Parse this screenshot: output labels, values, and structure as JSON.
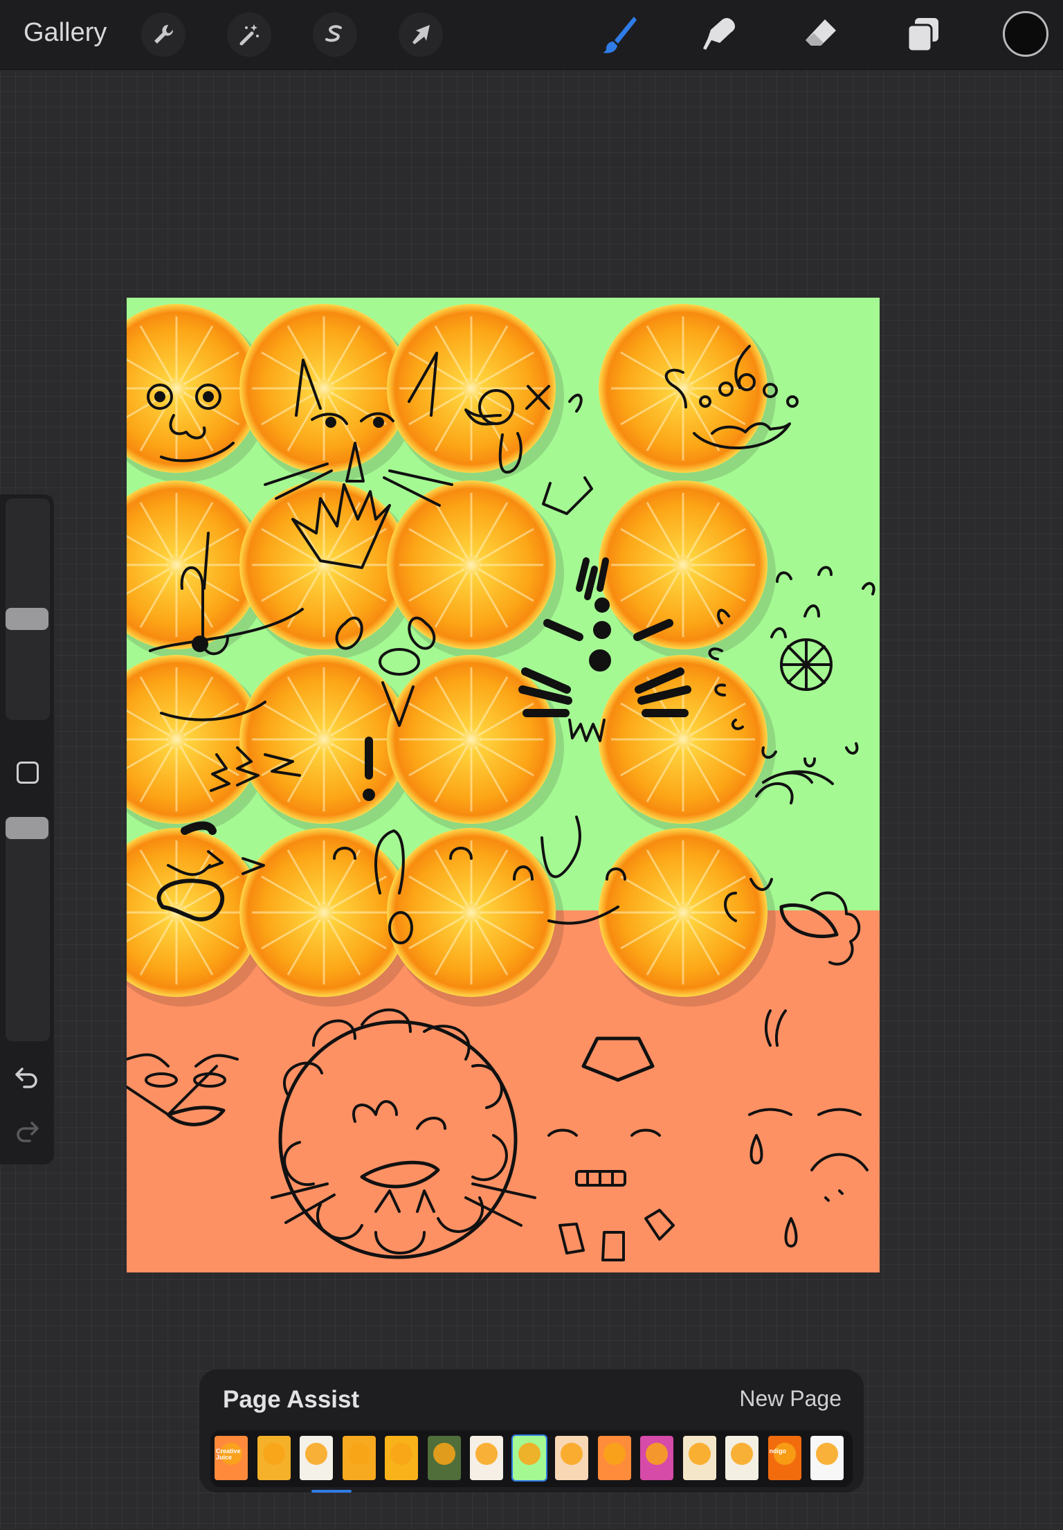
{
  "toolbar": {
    "gallery_label": "Gallery",
    "accent_color": "#2f7ce7",
    "current_color": "#0b0b0b",
    "left_tools": [
      "wrench-icon",
      "magic-wand-icon",
      "selection-icon",
      "transform-arrow-icon"
    ],
    "right_tools": [
      "brush-icon",
      "smudge-icon",
      "eraser-icon",
      "layers-icon"
    ]
  },
  "sidebar": {
    "size_slider_value": 0.45,
    "opacity_slider_value": 1.0
  },
  "canvas": {
    "top_background": "#a5f993",
    "bottom_background": "#fe9164",
    "artwork": "orange-slice-faces"
  },
  "page_assist": {
    "title": "Page Assist",
    "new_page_label": "New Page",
    "selected_page": 8,
    "thumbnails": [
      {
        "color": "#ff8a3c",
        "text": "Creative Juice"
      },
      {
        "color": "#f5b12a",
        "text": ""
      },
      {
        "color": "#f4f1e8",
        "text": ""
      },
      {
        "color": "#f7a91f",
        "text": ""
      },
      {
        "color": "#f9b21a",
        "text": ""
      },
      {
        "color": "#4f6e3a",
        "text": ""
      },
      {
        "color": "#f5efe6",
        "text": ""
      },
      {
        "color": "#a5f993",
        "text": ""
      },
      {
        "color": "#f8d7b5",
        "text": ""
      },
      {
        "color": "#ff8c3a",
        "text": ""
      },
      {
        "color": "#d64aa8",
        "text": ""
      },
      {
        "color": "#f4e6c8",
        "text": ""
      },
      {
        "color": "#f3efe2",
        "text": ""
      },
      {
        "color": "#f26c0e",
        "text": "ndigo"
      },
      {
        "color": "#f7f7f7",
        "text": ""
      }
    ]
  }
}
